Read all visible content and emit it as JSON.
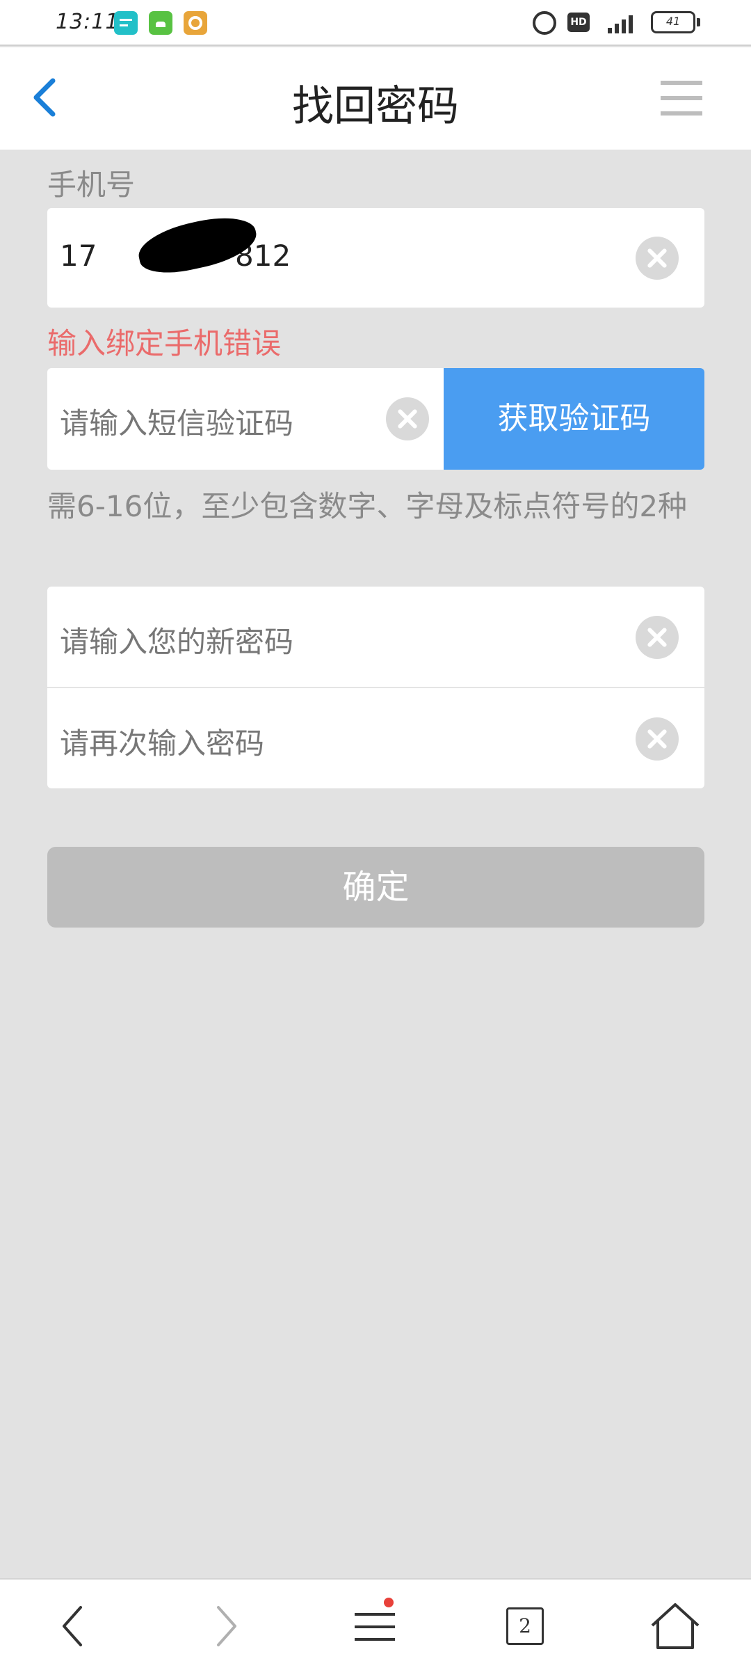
{
  "status_bar": {
    "time": "13:11",
    "hd_label": "HD",
    "battery": "41",
    "icons": [
      "message-app-icon",
      "android-app-icon",
      "settings-app-icon",
      "alarm-icon",
      "hd-icon",
      "signal-4g-icon",
      "battery-icon"
    ]
  },
  "header": {
    "title": "找回密码",
    "back_icon": "chevron-left-icon",
    "menu_icon": "hamburger-menu-icon"
  },
  "form": {
    "phone_label": "手机号",
    "phone_value_prefix": "17",
    "phone_value_suffix": "812",
    "phone_error": "输入绑定手机错误",
    "sms_placeholder": "请输入短信验证码",
    "get_code_label": "获取验证码",
    "password_hint": "需6-16位，至少包含数字、字母及标点符号的2种",
    "new_password_placeholder": "请输入您的新密码",
    "confirm_password_placeholder": "请再次输入密码",
    "confirm_label": "确定"
  },
  "bottom_nav": {
    "tab_count": "2",
    "icons": [
      "back-arrow-icon",
      "forward-arrow-icon",
      "menu-icon",
      "tabs-icon",
      "home-icon"
    ]
  },
  "colors": {
    "accent_blue": "#4a9df1",
    "back_blue": "#1a7fd8",
    "error_red": "#ea6b6b",
    "page_bg": "#e2e2e2",
    "disabled_button": "#bdbdbd"
  }
}
